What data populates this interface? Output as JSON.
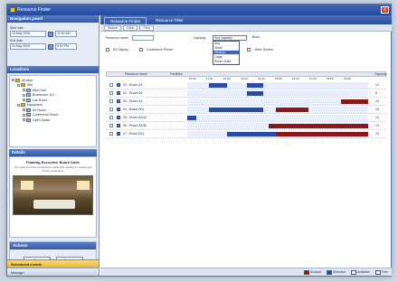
{
  "window": {
    "title": "Resource Finder",
    "close": "x"
  },
  "left": {
    "nav_header": "Navigation panel",
    "start_label": "Start date",
    "start_date": "24 May 2006",
    "start_time": "11:00 AM",
    "end_label": "End date",
    "end_date": "24 May 2006",
    "end_time": "5:00 PM",
    "locations_header": "Locations",
    "tree": [
      {
        "label": "All sites",
        "type": "folder",
        "indent": 0
      },
      {
        "label": "Site",
        "type": "folder",
        "indent": 1
      },
      {
        "label": "Main Hall",
        "type": "room",
        "indent": 2
      },
      {
        "label": "Boardroom 101",
        "type": "room",
        "indent": 2
      },
      {
        "label": "Lab Room",
        "type": "room",
        "indent": 2
      },
      {
        "label": "Equipment",
        "type": "folder",
        "indent": 1
      },
      {
        "label": "AV Room",
        "type": "room",
        "indent": 2
      },
      {
        "label": "Conference Room",
        "type": "room",
        "indent": 2
      },
      {
        "label": "Open Space",
        "type": "room",
        "indent": 2
      }
    ],
    "details_header": "Details",
    "detail_title": "Floating Executive Board Suite",
    "detail_text": "The suite includes a boardroom table with seating for twelve and full AV equipment.",
    "actions_header": "Actions",
    "btn_find": "Find",
    "btn_book": "Book It",
    "nav_primary": "Scheduled events",
    "nav_secondary": "Manage"
  },
  "main": {
    "tabs": [
      "Resource Finder",
      "Resource Filter"
    ],
    "toolbar": [
      "Search",
      "Clear",
      "Print"
    ],
    "filter_name_label": "Resource name",
    "filter_type_label": "Capacity",
    "dropdown_value": "Any capacity",
    "dropdown_options": [
      "Any",
      "Small",
      "Medium",
      "Large",
      "Room Suite"
    ],
    "opt_label": "Book",
    "chk1": "AV Display",
    "chk2": "Conference Phone",
    "chk3": "Video Screen",
    "col_room": "Resource name",
    "col_facilities": "Facilities",
    "col_capacity": "Capacity",
    "hours": [
      "10:00",
      "11:00",
      "12:00",
      "13:00",
      "14:00",
      "15:00",
      "16:00",
      "17:00",
      "18:00",
      "19:00"
    ],
    "rows": [
      {
        "name": "01 - Room A1",
        "cap": "12",
        "slots": [
          {
            "s": 0.12,
            "e": 0.22,
            "k": "conf"
          },
          {
            "s": 0.33,
            "e": 0.42,
            "k": "conf"
          }
        ]
      },
      {
        "name": "02 - Room B2",
        "cap": "8",
        "slots": [
          {
            "s": 0.33,
            "e": 0.42,
            "k": "conf"
          }
        ]
      },
      {
        "name": "03 - Room A3",
        "cap": "20",
        "slots": [
          {
            "s": 0.85,
            "e": 1.0,
            "k": "book"
          }
        ]
      },
      {
        "name": "04 - Board B01",
        "cap": "16",
        "slots": [
          {
            "s": 0.12,
            "e": 0.42,
            "k": "conf"
          },
          {
            "s": 0.49,
            "e": 0.67,
            "k": "book"
          }
        ]
      },
      {
        "name": "05 - Room B10A",
        "cap": "10",
        "slots": [
          {
            "s": 0.0,
            "e": 0.05,
            "k": "conf"
          }
        ]
      },
      {
        "name": "06 - Room B10B",
        "cap": "10",
        "slots": [
          {
            "s": 0.45,
            "e": 1.0,
            "k": "book"
          }
        ]
      },
      {
        "name": "07 - Room B11",
        "cap": "24",
        "slots": [
          {
            "s": 0.22,
            "e": 0.49,
            "k": "conf"
          },
          {
            "s": 0.49,
            "e": 1.0,
            "k": "book"
          }
        ]
      }
    ],
    "legend": [
      {
        "label": "Booked",
        "color": "#8a1818"
      },
      {
        "label": "Selected",
        "color": "#2a4aa8"
      },
      {
        "label": "Available",
        "color": "#ffffff"
      },
      {
        "label": "Free",
        "color": "#ffffff"
      }
    ]
  }
}
